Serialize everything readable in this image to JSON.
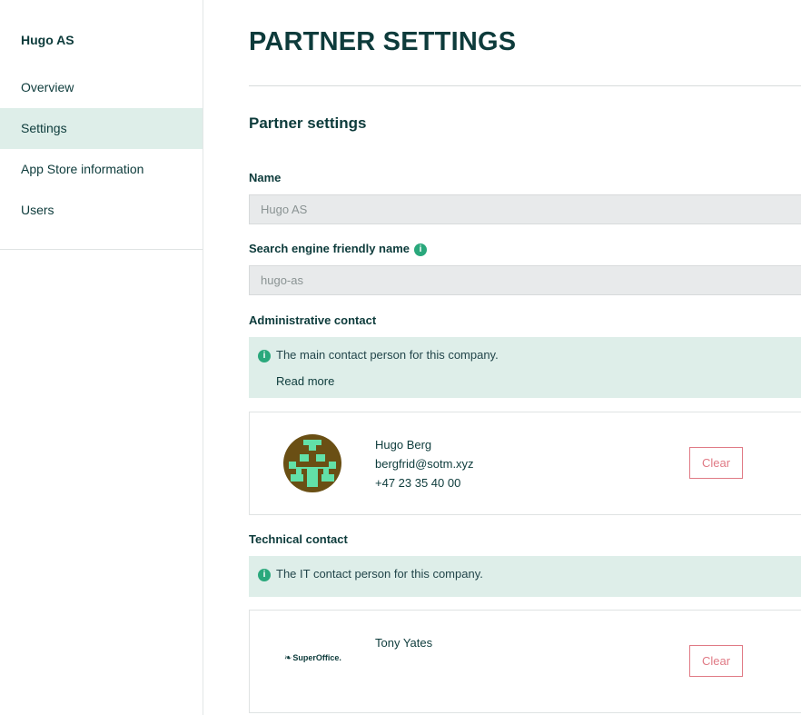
{
  "sidebar": {
    "org_name": "Hugo AS",
    "items": [
      {
        "label": "Overview"
      },
      {
        "label": "Settings"
      },
      {
        "label": "App Store information"
      },
      {
        "label": "Users"
      }
    ]
  },
  "page": {
    "title": "PARTNER SETTINGS",
    "section_title": "Partner settings"
  },
  "fields": {
    "name_label": "Name",
    "name_value": "Hugo AS",
    "seo_label": "Search engine friendly name",
    "seo_value": "hugo-as"
  },
  "admin_contact": {
    "label": "Administrative contact",
    "info": "The main contact person for this company.",
    "read_more": "Read more",
    "name": "Hugo Berg",
    "email": "bergfrid@sotm.xyz",
    "phone": "+47 23 35 40 00",
    "clear_label": "Clear",
    "avatar_icon": "pixel-avatar-icon"
  },
  "tech_contact": {
    "label": "Technical contact",
    "info": "The IT contact person for this company.",
    "name": "Tony Yates",
    "clear_label": "Clear",
    "logo_text": "SuperOffice."
  },
  "colors": {
    "accent_green": "#2aa87c",
    "active_nav_bg": "#deeee9",
    "clear_red": "#e07a85",
    "text_dark": "#0d3b3b"
  }
}
